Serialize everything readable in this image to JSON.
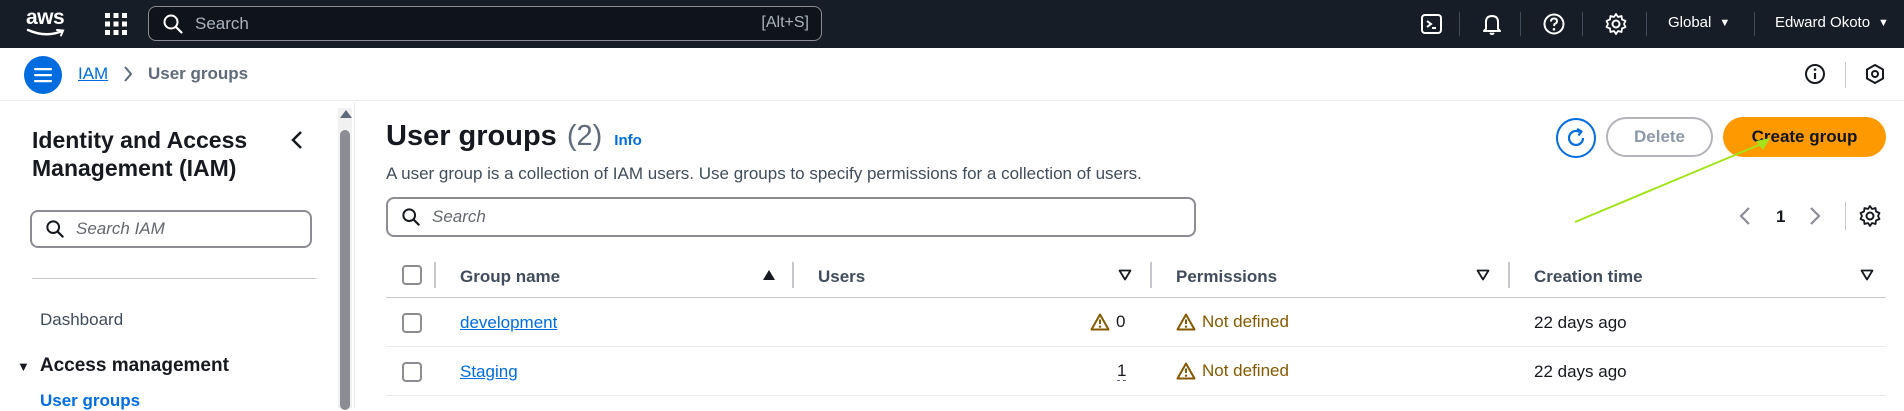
{
  "topnav": {
    "logo_text": "aws",
    "search_placeholder": "Search",
    "search_shortcut": "[Alt+S]",
    "region": "Global",
    "user": "Edward Okoto"
  },
  "breadcrumb": {
    "service": "IAM",
    "current": "User groups"
  },
  "sidenav": {
    "title": "Identity and Access Management (IAM)",
    "search_placeholder": "Search IAM",
    "dashboard": "Dashboard",
    "section": "Access management",
    "active_item": "User groups"
  },
  "main": {
    "title": "User groups",
    "count": "(2)",
    "info": "Info",
    "description": "A user group is a collection of IAM users. Use groups to specify permissions for a collection of users.",
    "delete_label": "Delete",
    "create_label": "Create group",
    "search_placeholder": "Search",
    "page": "1"
  },
  "table": {
    "columns": [
      "Group name",
      "Users",
      "Permissions",
      "Creation time"
    ],
    "rows": [
      {
        "name": "development",
        "users": "0",
        "permissions": "Not defined",
        "created": "22 days ago"
      },
      {
        "name": "Staging",
        "users": "1",
        "permissions": "Not defined",
        "created": "22 days ago"
      }
    ]
  },
  "colors": {
    "topnav_bg": "#161d26",
    "link": "#006ce0",
    "primary_button": "#ff9900",
    "warning": "#855900",
    "annotation_arrow": "#a4e31b"
  }
}
